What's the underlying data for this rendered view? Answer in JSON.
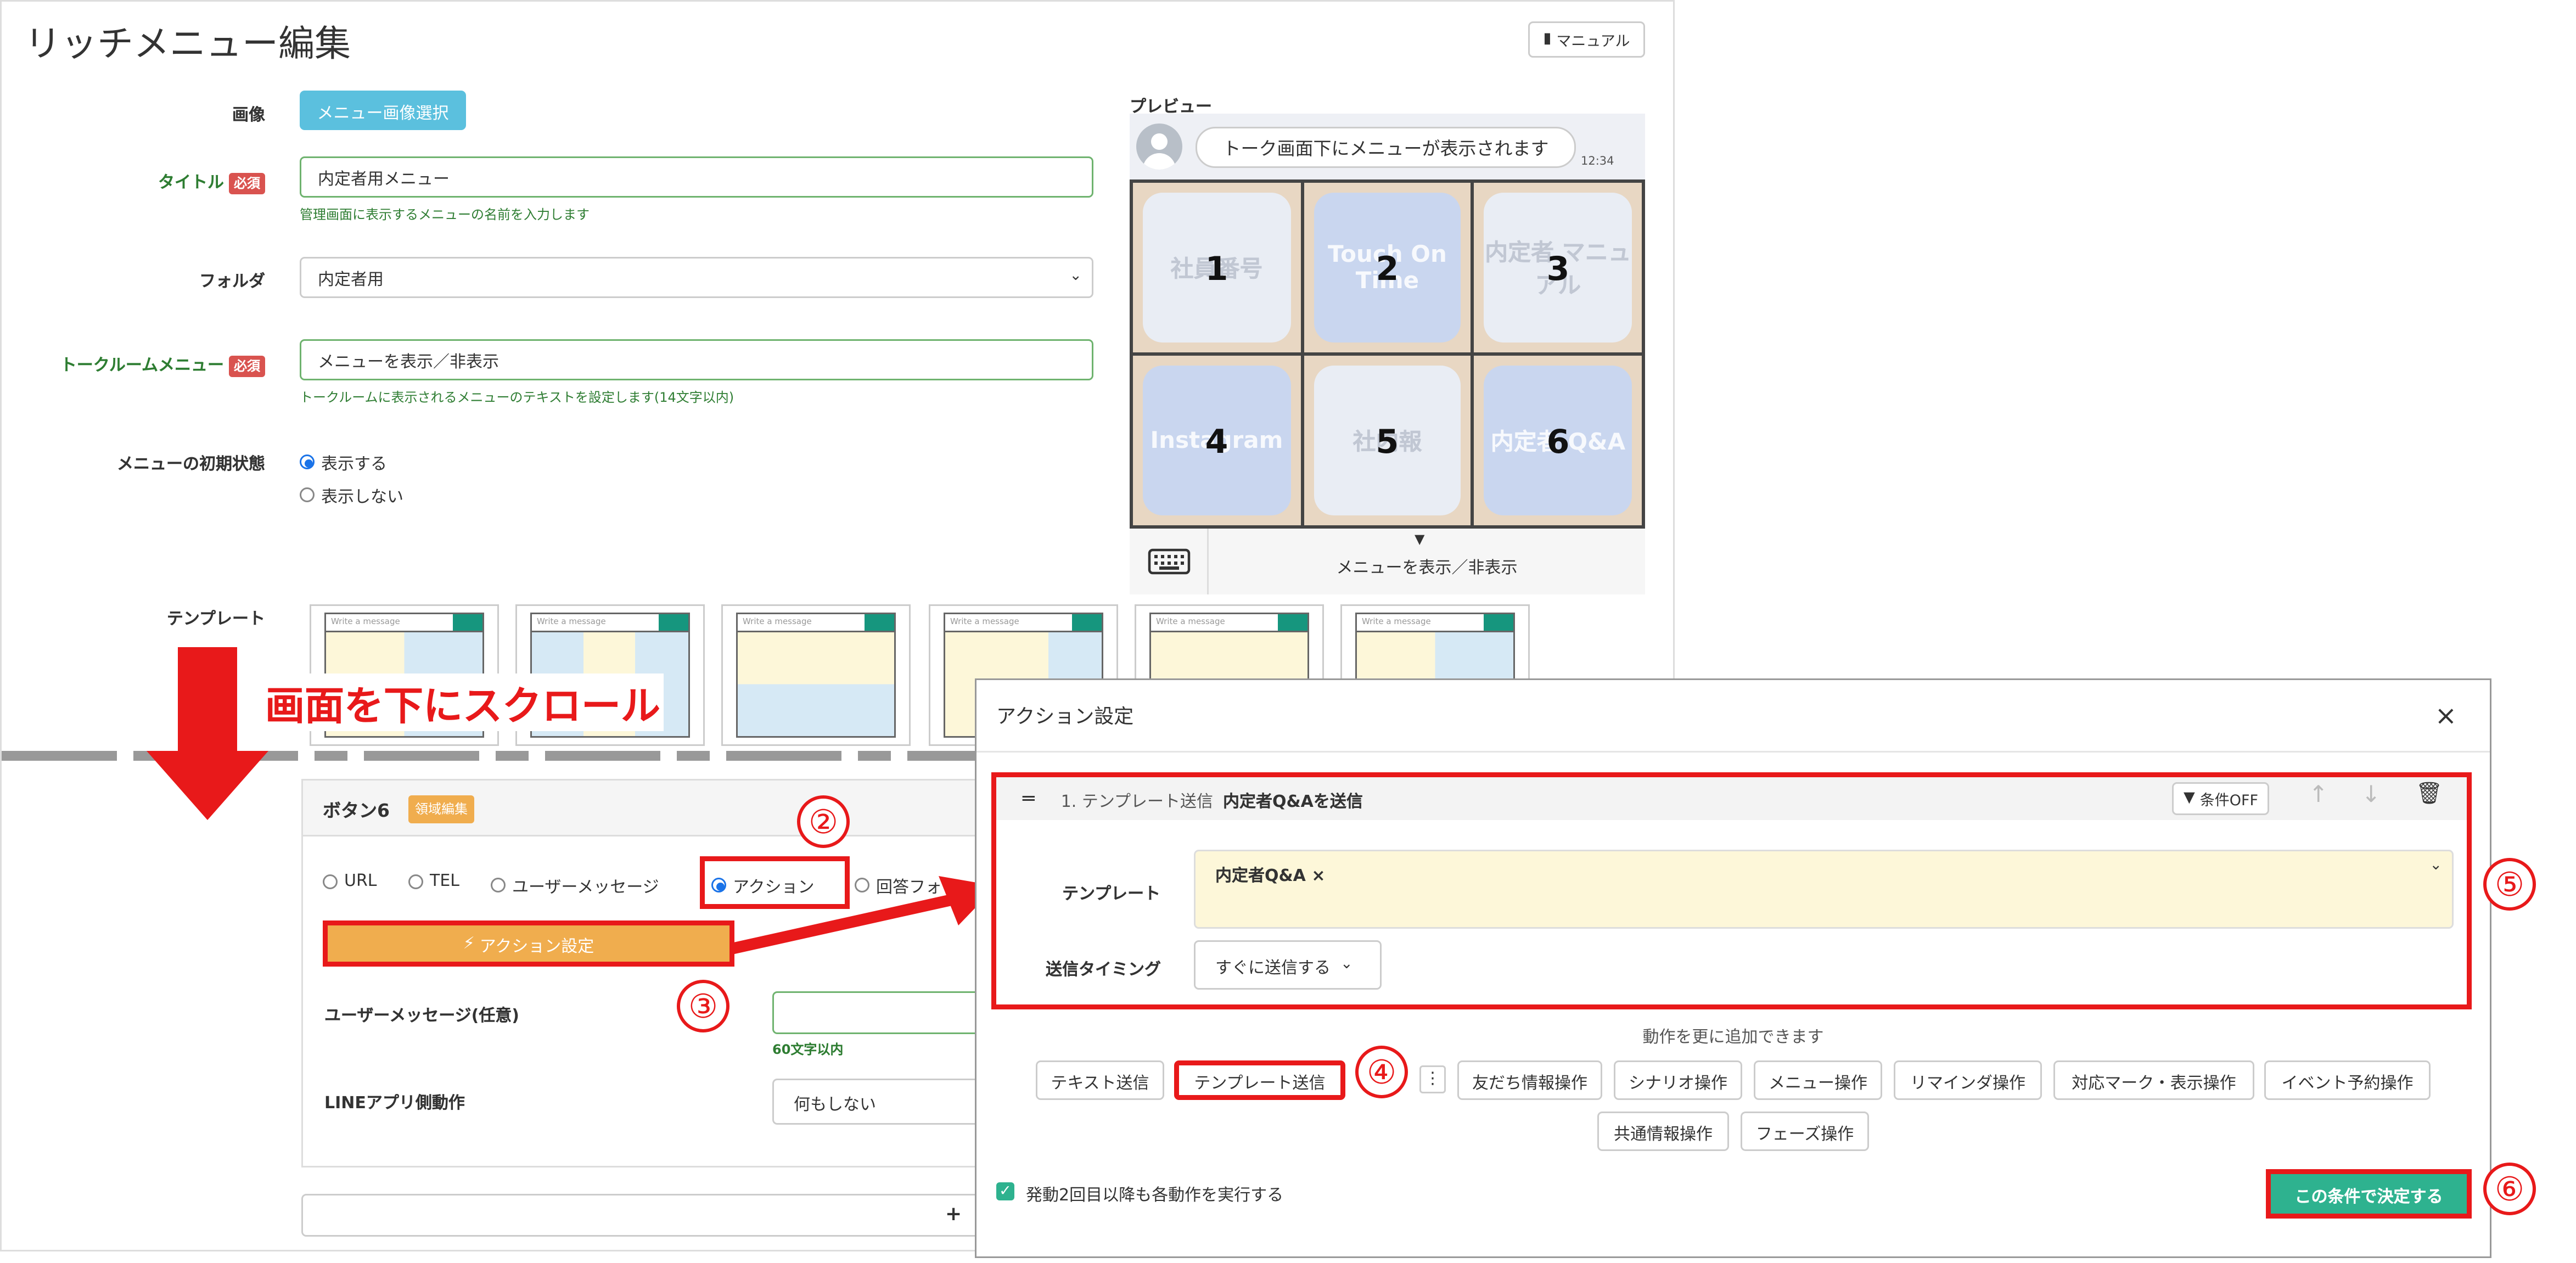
{
  "page": {
    "title": "リッチメニュー編集",
    "manual_label": "マニュアル"
  },
  "form": {
    "image_label": "画像",
    "image_button": "メニュー画像選択",
    "title_label": "タイトル",
    "required": "必須",
    "title_value": "内定者用メニュー",
    "title_help": "管理画面に表示するメニューの名前を入力します",
    "folder_label": "フォルダ",
    "folder_value": "内定者用",
    "talkroom_label": "トークルームメニュー",
    "talkroom_value": "メニューを表示／非表示",
    "talkroom_help": "トークルームに表示されるメニューのテキストを設定します(14文字以内)",
    "initial_label": "メニューの初期状態",
    "initial_options": [
      "表示する",
      "表示しない"
    ],
    "template_label": "テンプレート",
    "template_write": "Write a message"
  },
  "preview": {
    "label": "プレビュー",
    "bubble": "トーク画面下にメニューが表示されます",
    "time": "12:34",
    "tiles": [
      {
        "text": "社員番号",
        "num": "1",
        "style": "light"
      },
      {
        "text": "Touch On Time",
        "num": "2",
        "style": "blue"
      },
      {
        "text": "内定者 マニュアル",
        "num": "3",
        "style": "light"
      },
      {
        "text": "Instagram",
        "num": "4",
        "style": "blue"
      },
      {
        "text": "社内報",
        "num": "5",
        "style": "light"
      },
      {
        "text": "内定者 Q&A",
        "num": "6",
        "style": "blue"
      }
    ],
    "menu_bar": "メニューを表示／非表示"
  },
  "annotation": {
    "scroll_text": "画面を下にスクロール",
    "steps": [
      "②",
      "③",
      "④",
      "⑤",
      "⑥"
    ]
  },
  "button_panel": {
    "title": "ボタン6",
    "area_badge": "領域編集",
    "types": [
      "URL",
      "TEL",
      "ユーザーメッセージ",
      "アクション",
      "回答フォ"
    ],
    "action_button": "アクション設定",
    "user_msg_label": "ユーザーメッセージ(任意)",
    "user_msg_help": "60文字以内",
    "line_label": "LINEアプリ側動作",
    "line_value": "何もしない"
  },
  "modal": {
    "title": "アクション設定",
    "close": "×",
    "action_num": "1. テンプレート送信",
    "action_name": "内定者Q&Aを送信",
    "cond_off": "条件OFF",
    "template_label": "テンプレート",
    "template_value": "内定者Q&A ×",
    "timing_label": "送信タイミング",
    "timing_value": "すぐに送信する",
    "add_note": "動作を更に追加できます",
    "chips": [
      "テキスト送信",
      "テンプレート送信",
      "友だち情報操作",
      "シナリオ操作",
      "メニュー操作",
      "リマインダ操作",
      "対応マーク・表示操作",
      "イベント予約操作",
      "共通情報操作",
      "フェーズ操作"
    ],
    "repeat_label": "発動2回目以降も各動作を実行する",
    "confirm": "この条件で決定する"
  }
}
